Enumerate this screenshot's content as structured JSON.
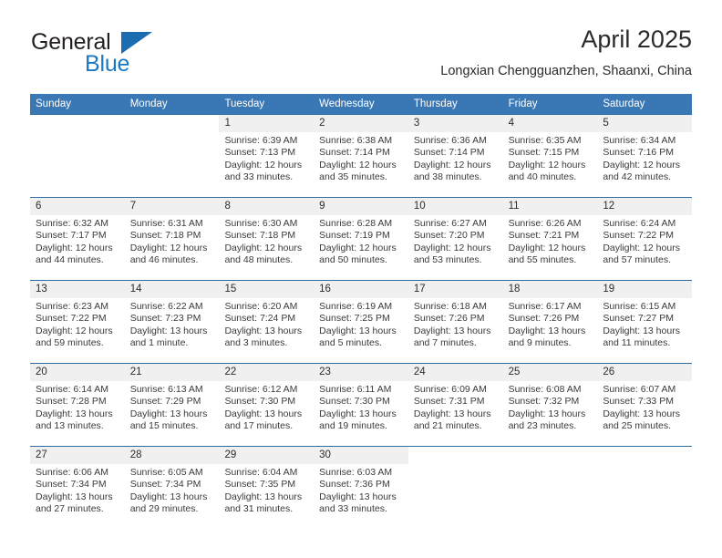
{
  "logo": {
    "word_one": "General",
    "word_two": "Blue",
    "triangle_icon": "triangle-icon",
    "color_dark": "#231f20",
    "color_blue": "#1b78c2"
  },
  "header": {
    "title": "April 2025",
    "subtitle": "Longxian Chengguanzhen, Shaanxi, China"
  },
  "theme": {
    "header_blue": "#3a78b5",
    "divider_blue": "#2e6da4",
    "number_band": "#f0f0f0"
  },
  "weekdays": [
    "Sunday",
    "Monday",
    "Tuesday",
    "Wednesday",
    "Thursday",
    "Friday",
    "Saturday"
  ],
  "weeks": [
    [
      {
        "day": "",
        "sunrise": "",
        "sunset": "",
        "daylight": ""
      },
      {
        "day": "",
        "sunrise": "",
        "sunset": "",
        "daylight": ""
      },
      {
        "day": "1",
        "sunrise": "Sunrise: 6:39 AM",
        "sunset": "Sunset: 7:13 PM",
        "daylight": "Daylight: 12 hours and 33 minutes."
      },
      {
        "day": "2",
        "sunrise": "Sunrise: 6:38 AM",
        "sunset": "Sunset: 7:14 PM",
        "daylight": "Daylight: 12 hours and 35 minutes."
      },
      {
        "day": "3",
        "sunrise": "Sunrise: 6:36 AM",
        "sunset": "Sunset: 7:14 PM",
        "daylight": "Daylight: 12 hours and 38 minutes."
      },
      {
        "day": "4",
        "sunrise": "Sunrise: 6:35 AM",
        "sunset": "Sunset: 7:15 PM",
        "daylight": "Daylight: 12 hours and 40 minutes."
      },
      {
        "day": "5",
        "sunrise": "Sunrise: 6:34 AM",
        "sunset": "Sunset: 7:16 PM",
        "daylight": "Daylight: 12 hours and 42 minutes."
      }
    ],
    [
      {
        "day": "6",
        "sunrise": "Sunrise: 6:32 AM",
        "sunset": "Sunset: 7:17 PM",
        "daylight": "Daylight: 12 hours and 44 minutes."
      },
      {
        "day": "7",
        "sunrise": "Sunrise: 6:31 AM",
        "sunset": "Sunset: 7:18 PM",
        "daylight": "Daylight: 12 hours and 46 minutes."
      },
      {
        "day": "8",
        "sunrise": "Sunrise: 6:30 AM",
        "sunset": "Sunset: 7:18 PM",
        "daylight": "Daylight: 12 hours and 48 minutes."
      },
      {
        "day": "9",
        "sunrise": "Sunrise: 6:28 AM",
        "sunset": "Sunset: 7:19 PM",
        "daylight": "Daylight: 12 hours and 50 minutes."
      },
      {
        "day": "10",
        "sunrise": "Sunrise: 6:27 AM",
        "sunset": "Sunset: 7:20 PM",
        "daylight": "Daylight: 12 hours and 53 minutes."
      },
      {
        "day": "11",
        "sunrise": "Sunrise: 6:26 AM",
        "sunset": "Sunset: 7:21 PM",
        "daylight": "Daylight: 12 hours and 55 minutes."
      },
      {
        "day": "12",
        "sunrise": "Sunrise: 6:24 AM",
        "sunset": "Sunset: 7:22 PM",
        "daylight": "Daylight: 12 hours and 57 minutes."
      }
    ],
    [
      {
        "day": "13",
        "sunrise": "Sunrise: 6:23 AM",
        "sunset": "Sunset: 7:22 PM",
        "daylight": "Daylight: 12 hours and 59 minutes."
      },
      {
        "day": "14",
        "sunrise": "Sunrise: 6:22 AM",
        "sunset": "Sunset: 7:23 PM",
        "daylight": "Daylight: 13 hours and 1 minute."
      },
      {
        "day": "15",
        "sunrise": "Sunrise: 6:20 AM",
        "sunset": "Sunset: 7:24 PM",
        "daylight": "Daylight: 13 hours and 3 minutes."
      },
      {
        "day": "16",
        "sunrise": "Sunrise: 6:19 AM",
        "sunset": "Sunset: 7:25 PM",
        "daylight": "Daylight: 13 hours and 5 minutes."
      },
      {
        "day": "17",
        "sunrise": "Sunrise: 6:18 AM",
        "sunset": "Sunset: 7:26 PM",
        "daylight": "Daylight: 13 hours and 7 minutes."
      },
      {
        "day": "18",
        "sunrise": "Sunrise: 6:17 AM",
        "sunset": "Sunset: 7:26 PM",
        "daylight": "Daylight: 13 hours and 9 minutes."
      },
      {
        "day": "19",
        "sunrise": "Sunrise: 6:15 AM",
        "sunset": "Sunset: 7:27 PM",
        "daylight": "Daylight: 13 hours and 11 minutes."
      }
    ],
    [
      {
        "day": "20",
        "sunrise": "Sunrise: 6:14 AM",
        "sunset": "Sunset: 7:28 PM",
        "daylight": "Daylight: 13 hours and 13 minutes."
      },
      {
        "day": "21",
        "sunrise": "Sunrise: 6:13 AM",
        "sunset": "Sunset: 7:29 PM",
        "daylight": "Daylight: 13 hours and 15 minutes."
      },
      {
        "day": "22",
        "sunrise": "Sunrise: 6:12 AM",
        "sunset": "Sunset: 7:30 PM",
        "daylight": "Daylight: 13 hours and 17 minutes."
      },
      {
        "day": "23",
        "sunrise": "Sunrise: 6:11 AM",
        "sunset": "Sunset: 7:30 PM",
        "daylight": "Daylight: 13 hours and 19 minutes."
      },
      {
        "day": "24",
        "sunrise": "Sunrise: 6:09 AM",
        "sunset": "Sunset: 7:31 PM",
        "daylight": "Daylight: 13 hours and 21 minutes."
      },
      {
        "day": "25",
        "sunrise": "Sunrise: 6:08 AM",
        "sunset": "Sunset: 7:32 PM",
        "daylight": "Daylight: 13 hours and 23 minutes."
      },
      {
        "day": "26",
        "sunrise": "Sunrise: 6:07 AM",
        "sunset": "Sunset: 7:33 PM",
        "daylight": "Daylight: 13 hours and 25 minutes."
      }
    ],
    [
      {
        "day": "27",
        "sunrise": "Sunrise: 6:06 AM",
        "sunset": "Sunset: 7:34 PM",
        "daylight": "Daylight: 13 hours and 27 minutes."
      },
      {
        "day": "28",
        "sunrise": "Sunrise: 6:05 AM",
        "sunset": "Sunset: 7:34 PM",
        "daylight": "Daylight: 13 hours and 29 minutes."
      },
      {
        "day": "29",
        "sunrise": "Sunrise: 6:04 AM",
        "sunset": "Sunset: 7:35 PM",
        "daylight": "Daylight: 13 hours and 31 minutes."
      },
      {
        "day": "30",
        "sunrise": "Sunrise: 6:03 AM",
        "sunset": "Sunset: 7:36 PM",
        "daylight": "Daylight: 13 hours and 33 minutes."
      },
      {
        "day": "",
        "sunrise": "",
        "sunset": "",
        "daylight": ""
      },
      {
        "day": "",
        "sunrise": "",
        "sunset": "",
        "daylight": ""
      },
      {
        "day": "",
        "sunrise": "",
        "sunset": "",
        "daylight": ""
      }
    ]
  ]
}
